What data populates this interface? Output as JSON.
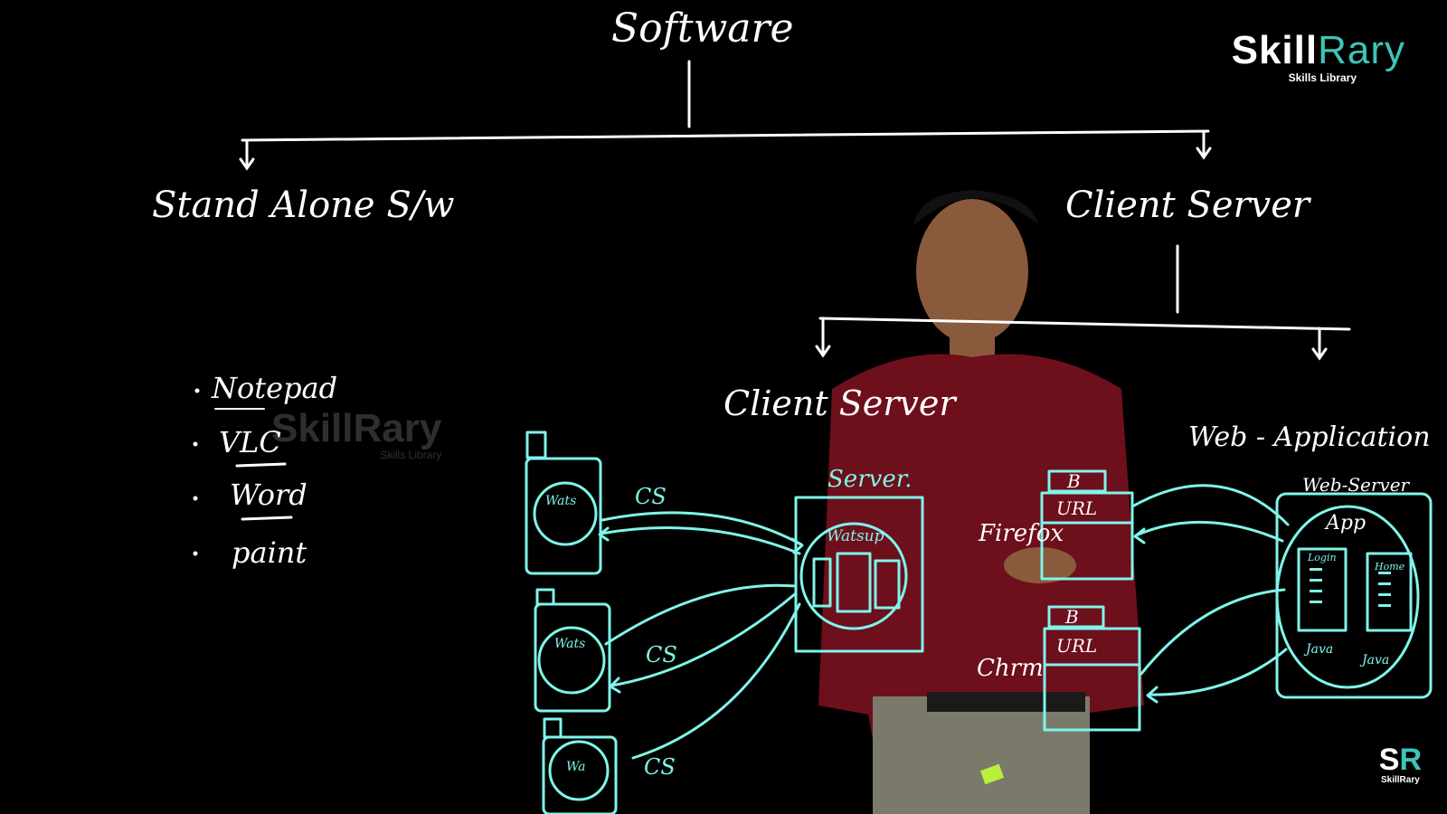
{
  "board": {
    "title": "Software",
    "left_branch": "Stand Alone S/w",
    "right_branch": "Client Server",
    "standalone_examples": [
      "Notepad",
      "VLC",
      "Word",
      "paint"
    ],
    "sub_left": "Client Server",
    "sub_right": "Web - Application",
    "server_label": "Server.",
    "server_app": "Watsup",
    "client_apps": [
      "Wats",
      "Wats",
      "Wa"
    ],
    "client_tag": "CS",
    "browser_tab": "B",
    "browser_url": "URL",
    "browser_labels": [
      "Firefox",
      "Chrm"
    ],
    "webserver_label": "Web-Server",
    "webserver_app": "App",
    "page_labels": [
      "Login",
      "Home"
    ],
    "page_tech": [
      "Java",
      "Java"
    ]
  },
  "branding": {
    "logo_skill": "Skill",
    "logo_rary": "Rary",
    "logo_tagline": "Skills Library",
    "corner_mark_s": "S",
    "corner_mark_r": "R",
    "corner_name": "SkillRary",
    "accent_color": "#3ec4b7",
    "ink_color": "#7ff5ea"
  }
}
